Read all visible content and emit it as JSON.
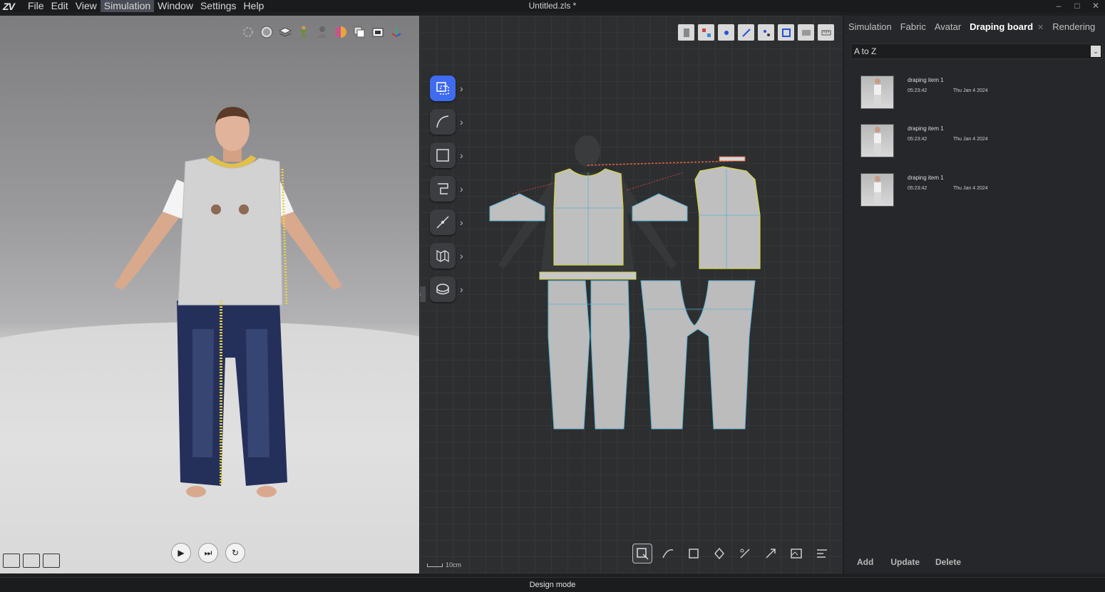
{
  "app": {
    "logo": "ZV",
    "document_title": "Untitled.zls *"
  },
  "menu": {
    "items": [
      {
        "label": "File"
      },
      {
        "label": "Edit"
      },
      {
        "label": "View"
      },
      {
        "label": "Simulation"
      },
      {
        "label": "Window"
      },
      {
        "label": "Settings"
      },
      {
        "label": "Help"
      }
    ],
    "active": "Simulation"
  },
  "window_controls": {
    "minimize": "–",
    "maximize": "□",
    "close": "✕"
  },
  "viewport3d": {
    "toolbar_icons": [
      "wind-icon",
      "sphere-icon",
      "layers-icon",
      "avatar-pose-icon",
      "avatar-icon",
      "texture-icon",
      "copy-icon",
      "camera-icon",
      "axis-icon"
    ],
    "playback": {
      "play": "▶",
      "step": "⏭",
      "reset": "↻"
    },
    "corner_icons": [
      "snapshot-icon",
      "zoom-image-icon",
      "screenshot-camera-icon"
    ]
  },
  "viewport2d": {
    "top_tools": [
      "garment-icon",
      "grade-icon",
      "show-points-icon",
      "show-seams-icon",
      "show-points-alt-icon",
      "show-baselines-icon",
      "show-texture-icon",
      "ruler-icon"
    ],
    "left_tools": [
      "select-transform-tool",
      "curve-tool",
      "rectangle-tool",
      "sewing-tool",
      "line-tool",
      "fold-tool",
      "measure-tool"
    ],
    "bottom_tools": [
      "select-mesh-tool",
      "edit-curve-tool",
      "trace-tool",
      "pin-tool",
      "cut-tool",
      "split-tool",
      "texture-edit-tool",
      "auto-arrange-tool"
    ],
    "scale_label": "10cm",
    "collapse_symbol": "◂"
  },
  "right_panel": {
    "tabs": [
      {
        "label": "Simulation"
      },
      {
        "label": "Fabric"
      },
      {
        "label": "Avatar"
      },
      {
        "label": "Draping board"
      },
      {
        "label": "Rendering"
      }
    ],
    "active_tab": "Draping board",
    "close_symbol": "✕",
    "sort": {
      "value": "A to Z",
      "arrow": "⌄"
    },
    "items": [
      {
        "name": "draping item 1",
        "time": "05:23:42",
        "date": "Thu Jan 4 2024"
      },
      {
        "name": "draping item 1",
        "time": "05:23:42",
        "date": "Thu Jan 4 2024"
      },
      {
        "name": "draping item 1",
        "time": "05:23:42",
        "date": "Thu Jan 4 2024"
      }
    ],
    "buttons": {
      "add": "Add",
      "update": "Update",
      "delete": "Delete"
    }
  },
  "status": {
    "mode": "Design mode"
  },
  "colors": {
    "accent": "#3f6bf0",
    "panel": "#26272a",
    "background": "#1e1f21"
  }
}
